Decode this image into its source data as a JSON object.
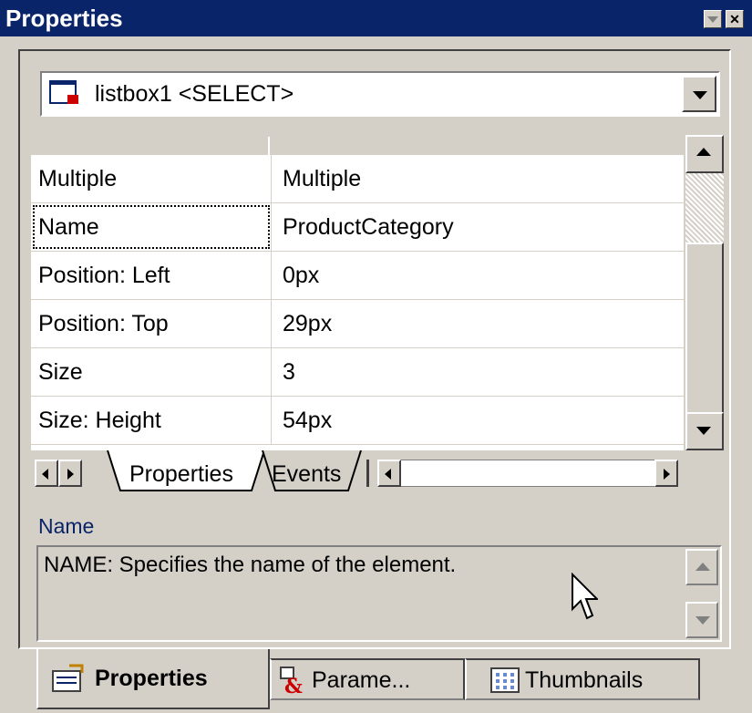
{
  "window": {
    "title": "Properties"
  },
  "selector": {
    "value": "listbox1 <SELECT>"
  },
  "properties": [
    {
      "name": "Multiple",
      "value": "Multiple"
    },
    {
      "name": "Name",
      "value": "ProductCategory"
    },
    {
      "name": "Position: Left",
      "value": "0px"
    },
    {
      "name": "Position: Top",
      "value": "29px"
    },
    {
      "name": "Size",
      "value": "3"
    },
    {
      "name": "Size: Height",
      "value": "54px"
    }
  ],
  "grid_tabs": [
    {
      "label": "Properties"
    },
    {
      "label": "Events"
    }
  ],
  "description": {
    "title": "Name",
    "text": "NAME: Specifies the name of the element."
  },
  "bottom_tabs": [
    {
      "label": "Properties"
    },
    {
      "label": "Parame..."
    },
    {
      "label": "Thumbnails"
    }
  ],
  "colors": {
    "titlebar": "#0a246a",
    "face": "#d4d0c8",
    "desc_title": "#0a246a"
  }
}
